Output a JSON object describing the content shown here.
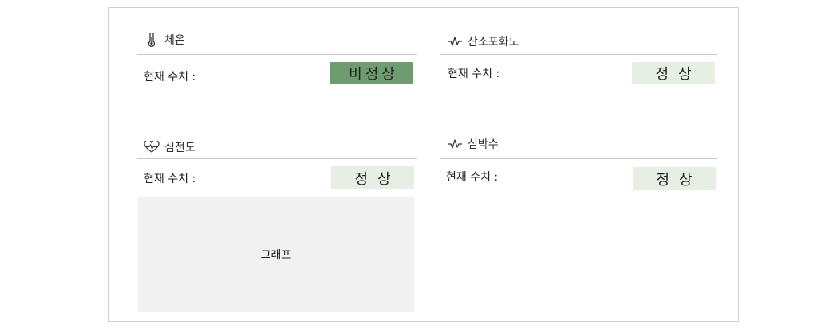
{
  "panels": {
    "temperature": {
      "title": "체온",
      "icon": "thermometer-icon",
      "current_label": "현재 수치 :",
      "status": "비정상"
    },
    "oxygen": {
      "title": "산소포화도",
      "icon": "pulse-line-icon",
      "current_label": "현재 수치 :",
      "status": "정상"
    },
    "ecg": {
      "title": "심전도",
      "icon": "heart-pulse-icon",
      "current_label": "현재 수치 :",
      "status": "정상",
      "graph_label": "그래프"
    },
    "heart_rate": {
      "title": "심박수",
      "icon": "pulse-line-icon",
      "current_label": "현재 수치 :",
      "status": "정상"
    }
  },
  "colors": {
    "normal_badge": "#e7efe5",
    "abnormal_badge": "#6e9c70",
    "graph_bg": "#f1f1f1"
  }
}
